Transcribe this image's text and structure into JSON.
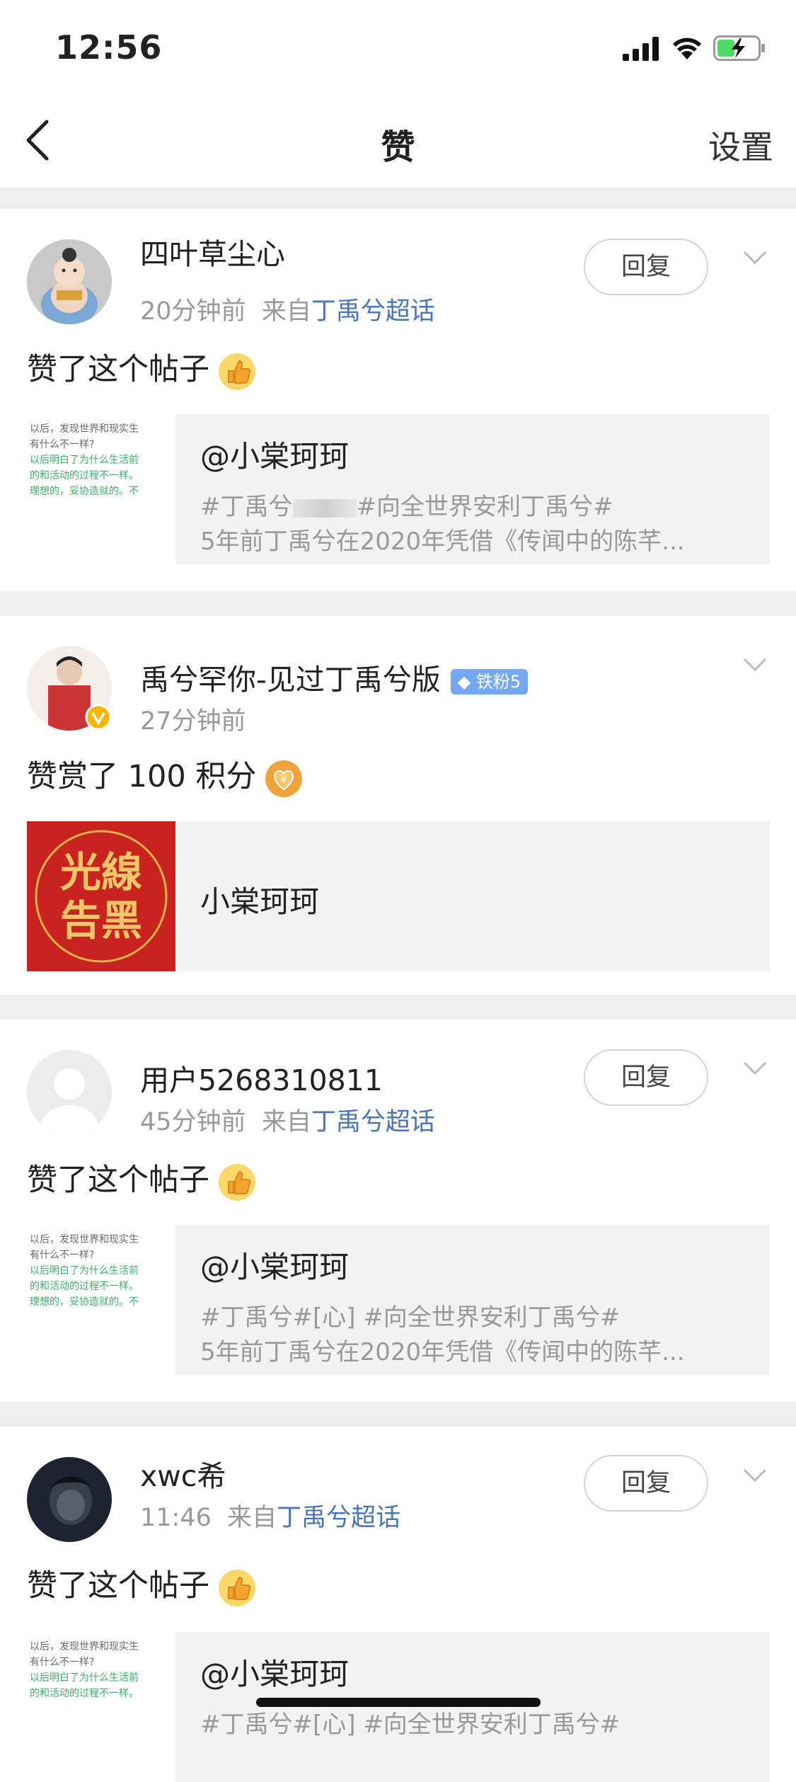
{
  "status": {
    "time": "12:56"
  },
  "nav": {
    "title": "赞",
    "settings": "设置"
  },
  "notifications": [
    {
      "name": "四叶草尘心",
      "time": "20分钟前",
      "from_prefix": "来自",
      "source": "丁禹兮超话",
      "reply": "回复",
      "action": "赞了这个帖子",
      "emoji": "thumbs-up-icon",
      "quote": {
        "author": "@小棠珂珂",
        "line1": "#丁禹兮",
        "line1_end": "#向全世界安利丁禹兮#",
        "line2": "5年前丁禹兮在2020年凭借《传闻中的陈芊..."
      }
    },
    {
      "name": "禹兮罕你-见过丁禹兮版",
      "badge": "铁粉5",
      "time": "27分钟前",
      "action": "赞赏了 100 积分",
      "emoji": "coin-heart-icon",
      "quote": {
        "thumb_text_1": "光線",
        "thumb_text_2": "告黑",
        "author": "小棠珂珂"
      }
    },
    {
      "name": "用户5268310811",
      "time": "45分钟前",
      "from_prefix": "来自",
      "source": "丁禹兮超话",
      "reply": "回复",
      "action": "赞了这个帖子",
      "emoji": "thumbs-up-icon",
      "quote": {
        "author": "@小棠珂珂",
        "line1": "#丁禹兮#[心] #向全世界安利丁禹兮#",
        "line2": "5年前丁禹兮在2020年凭借《传闻中的陈芊..."
      }
    },
    {
      "name": "xwc希",
      "time": "11:46",
      "from_prefix": "来自",
      "source": "丁禹兮超话",
      "reply": "回复",
      "action": "赞了这个帖子",
      "emoji": "thumbs-up-icon",
      "quote": {
        "author": "@小棠珂珂",
        "line1": "#丁禹兮#[心] #向全世界安利丁禹兮#"
      }
    }
  ],
  "post_thumb_lines": [
    "以后，发现世界和现实生",
    "有什么不一样?",
    "以后明白了为什么生活前",
    "的和活动的过程不一样。",
    "理想的，妥协造就的。不"
  ],
  "colors": {
    "link": "#4a74b3",
    "badge": "#74a8ef",
    "divider": "#efefef"
  }
}
